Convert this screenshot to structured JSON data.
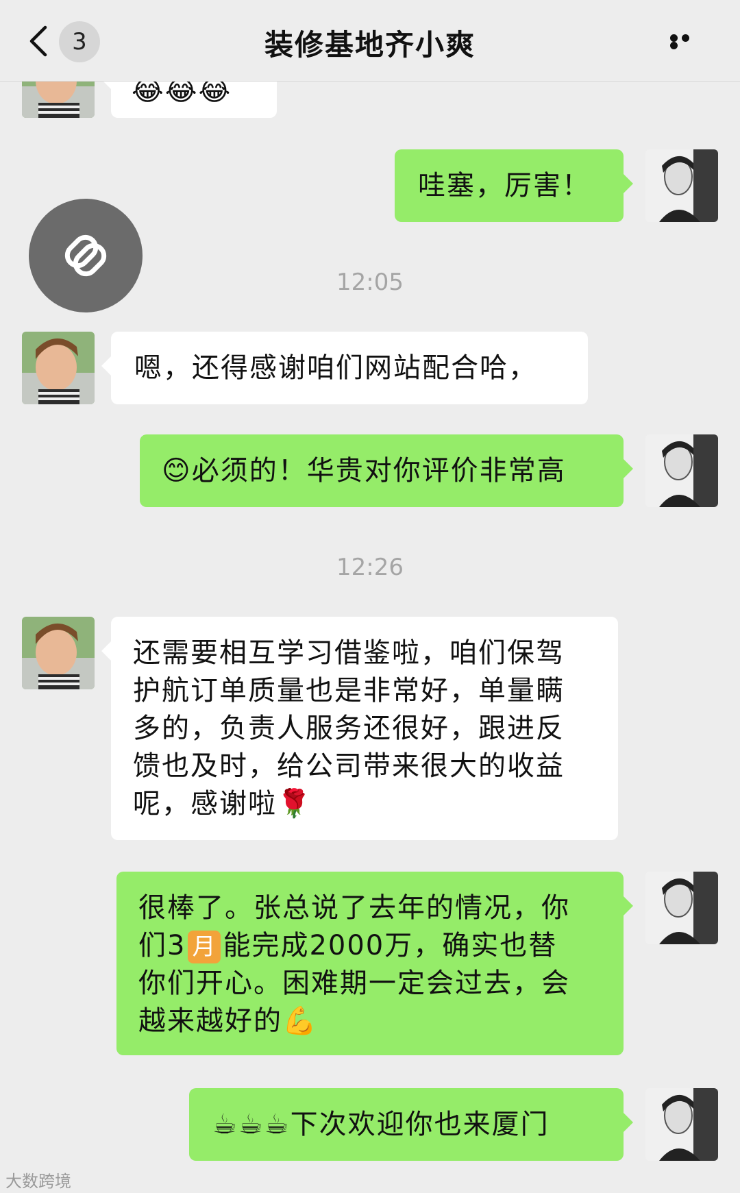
{
  "header": {
    "badge_count": "3",
    "title": "装修基地齐小爽"
  },
  "messages": [
    {
      "side": "in",
      "emoji": "😂😂😂"
    },
    {
      "side": "out",
      "text": "哇塞，厉害！"
    },
    {
      "time": "12:05"
    },
    {
      "side": "in",
      "text": "嗯，还得感谢咱们网站配合哈，"
    },
    {
      "side": "out",
      "emoji": "😊",
      "text": "必须的！华贵对你评价非常高"
    },
    {
      "time": "12:26"
    },
    {
      "side": "in",
      "lines": [
        "还需要相互学习借鉴啦，咱们保驾",
        "护航订单质量也是非常好，单量瞒",
        "多的，负责人服务还很好，跟进反",
        "馈也及时，给公司带来很大的收益",
        "呢，感谢啦"
      ],
      "emoji": "🌹"
    },
    {
      "side": "out",
      "lines": [
        "很棒了。张总说了去年的情况，你",
        "们3",
        "能完成2000万，确实也替",
        "你们开心。困难期一定会过去，会",
        "越来越好的"
      ],
      "month_icon": "月",
      "emoji": "💪"
    },
    {
      "side": "out",
      "emoji": "☕☕☕",
      "text": "下次欢迎你也来厦门"
    }
  ],
  "watermark": "大数跨境",
  "colors": {
    "background": "#ededed",
    "sent_bubble": "#95ec69",
    "received_bubble": "#ffffff"
  }
}
